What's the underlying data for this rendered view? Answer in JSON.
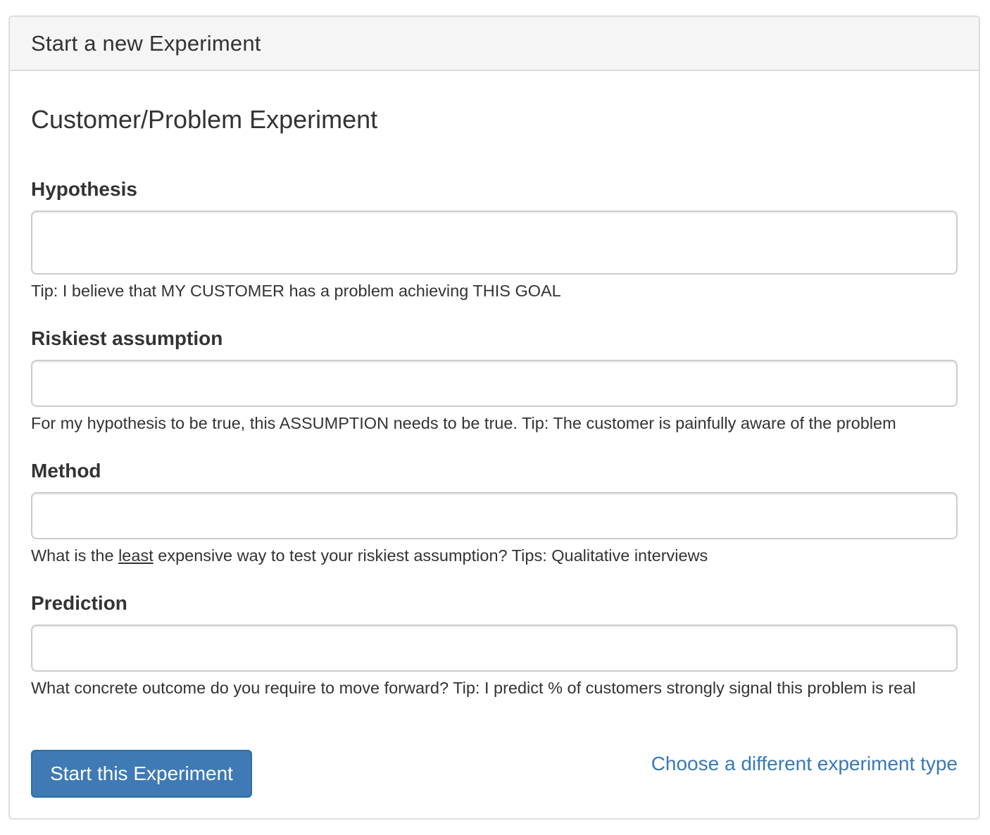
{
  "panel": {
    "heading": "Start a new Experiment"
  },
  "form": {
    "title": "Customer/Problem Experiment",
    "hypothesis": {
      "label": "Hypothesis",
      "value": "",
      "help": "Tip: I believe that MY CUSTOMER has a problem achieving THIS GOAL"
    },
    "riskiest_assumption": {
      "label": "Riskiest assumption",
      "value": "",
      "help": "For my hypothesis to be true, this ASSUMPTION needs to be true. Tip: The customer is painfully aware of the problem"
    },
    "method": {
      "label": "Method",
      "value": "",
      "help_before": "What is the ",
      "help_emphasis": "least",
      "help_after": " expensive way to test your riskiest assumption? Tips: Qualitative interviews"
    },
    "prediction": {
      "label": "Prediction",
      "value": "",
      "help": "What concrete outcome do you require to move forward? Tip: I predict % of customers strongly signal this problem is real"
    },
    "submit_label": "Start this Experiment",
    "alt_link_label": "Choose a different experiment type"
  },
  "colors": {
    "primary_button": "#3f7ab4",
    "link": "#3a78b5",
    "panel_heading_bg": "#f5f5f5",
    "border": "#dddddd"
  }
}
